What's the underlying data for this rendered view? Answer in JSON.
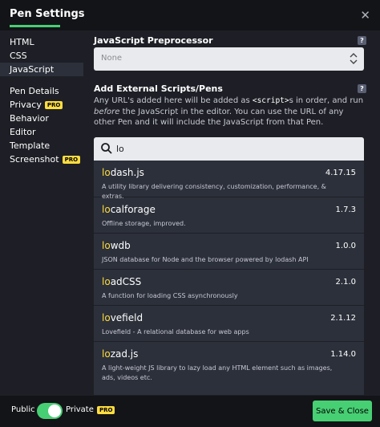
{
  "header": {
    "title": "Pen Settings",
    "close_icon": "close-icon",
    "accent": "#47cf73"
  },
  "sidebar": {
    "items": [
      {
        "label": "HTML"
      },
      {
        "label": "CSS"
      },
      {
        "label": "JavaScript",
        "active": true
      },
      {
        "label": "Pen Details"
      },
      {
        "label": "Privacy",
        "badge": "PRO"
      },
      {
        "label": "Behavior"
      },
      {
        "label": "Editor"
      },
      {
        "label": "Template"
      },
      {
        "label": "Screenshot",
        "badge": "PRO"
      }
    ]
  },
  "preprocessor": {
    "heading": "JavaScript Preprocessor",
    "help": "?",
    "value": "None"
  },
  "external": {
    "heading": "Add External Scripts/Pens",
    "help": "?",
    "desc_1": "Any URL's added here will be added as ",
    "desc_code": "<script>",
    "desc_2": "s in order, and run ",
    "desc_em": "before",
    "desc_3": " the JavaScript in the editor. You can use the URL of any other Pen and it will include the JavaScript from that Pen."
  },
  "search": {
    "value": "lo",
    "icon": "search-icon"
  },
  "results": [
    {
      "hl": "lo",
      "rest": "dash.js",
      "version": "4.17.15",
      "desc": "A utility library delivering consistency, customization, performance, & extras."
    },
    {
      "hl": "lo",
      "rest": "calforage",
      "version": "1.7.3",
      "desc": "Offline storage, improved."
    },
    {
      "hl": "lo",
      "rest": "wdb",
      "version": "1.0.0",
      "desc": "JSON database for Node and the browser powered by lodash API"
    },
    {
      "hl": "lo",
      "rest": "adCSS",
      "version": "2.1.0",
      "desc": "A function for loading CSS asynchronously"
    },
    {
      "hl": "lo",
      "rest": "vefield",
      "version": "2.1.12",
      "desc": "Lovefield - A relational database for web apps"
    },
    {
      "hl": "lo",
      "rest": "zad.js",
      "version": "1.14.0",
      "desc": "A light-weight JS library to lazy load any HTML element such as images, ads, videos etc."
    }
  ],
  "footer": {
    "public": "Public",
    "private": "Private",
    "badge": "PRO",
    "save": "Save & Close"
  },
  "colors": {
    "badge": "#ffdd40",
    "highlight": "#ffdd40",
    "button": "#47cf73"
  }
}
